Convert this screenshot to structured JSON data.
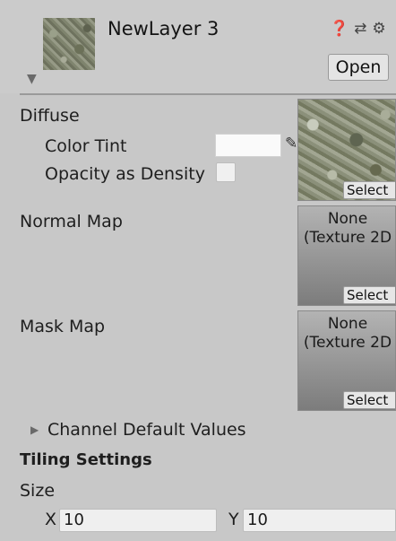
{
  "header": {
    "layer_name": "NewLayer 3",
    "open_label": "Open",
    "icons": [
      "help-icon",
      "preset-icon",
      "settings-icon"
    ]
  },
  "diffuse": {
    "label": "Diffuse",
    "color_tint_label": "Color Tint",
    "opacity_label": "Opacity as Density",
    "select_label": "Select"
  },
  "normal_map": {
    "label": "Normal Map",
    "value_line1": "None",
    "value_line2": "(Texture 2D",
    "select_label": "Select"
  },
  "mask_map": {
    "label": "Mask Map",
    "value_line1": "None",
    "value_line2": "(Texture 2D",
    "select_label": "Select"
  },
  "channel_defaults": {
    "label": "Channel Default Values"
  },
  "tiling": {
    "heading": "Tiling Settings",
    "size_label": "Size",
    "x_label": "X",
    "x_value": "10",
    "y_label": "Y",
    "y_value": "10"
  },
  "colors": {
    "panel_bg": "#c8c8c8",
    "field_bg": "#efefef",
    "tint_color": "#fafafa"
  }
}
